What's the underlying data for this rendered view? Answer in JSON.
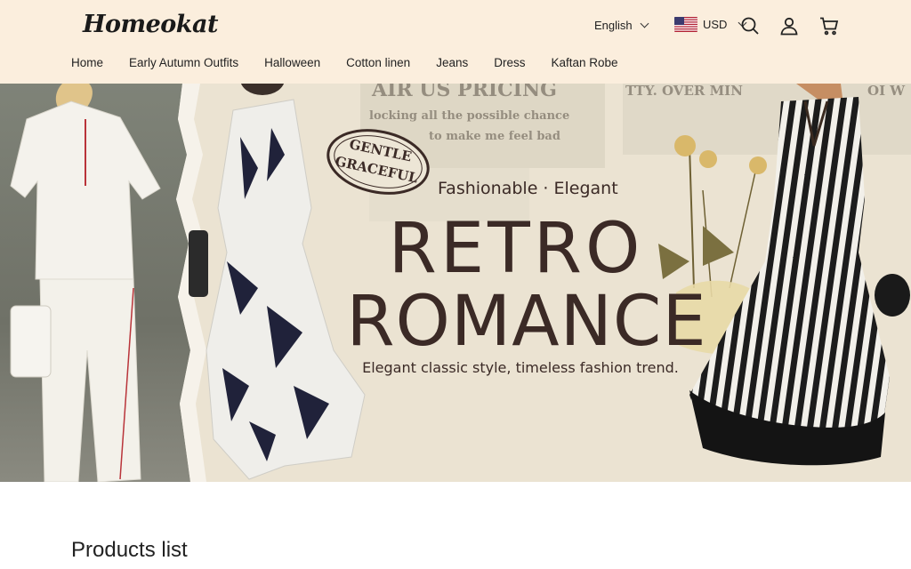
{
  "header": {
    "logo": "Homeokat",
    "language": "English",
    "currency": "USD"
  },
  "nav": {
    "items": [
      "Home",
      "Early Autumn Outfits",
      "Halloween",
      "Cotton linen",
      "Jeans",
      "Dress",
      "Kaftan Robe"
    ]
  },
  "hero": {
    "stamp_line1": "GENTLE",
    "stamp_line2": "GRACEFUL",
    "tagline": "Fashionable · Elegant",
    "title_line1": "RETRO",
    "title_line2": "ROMANCE",
    "subtitle": "Elegant classic style, timeless fashion trend.",
    "news_text_1": "AIR US  PRICING",
    "news_text_2": "locking all the possible chance",
    "news_text_3": "to make me feel bad",
    "news_text_4": "TTY. OVER MIN",
    "news_text_5": "OI W"
  },
  "products": {
    "title": "Products list"
  },
  "colors": {
    "header_bg": "#fbeedd",
    "hero_text": "#3b2a26"
  },
  "icons": [
    "search-icon",
    "user-icon",
    "cart-icon",
    "us-flag-icon"
  ]
}
